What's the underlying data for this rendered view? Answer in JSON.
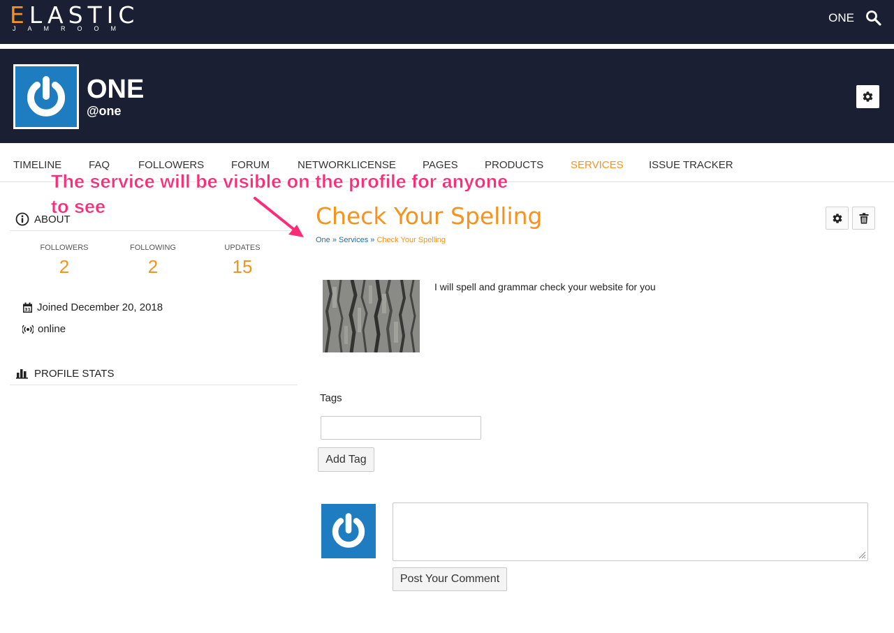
{
  "topbar": {
    "logo_first": "E",
    "logo_rest": "LASTIC",
    "logo_sub": "JAMROOM",
    "user_label": "ONE",
    "search_icon": "search-icon"
  },
  "profile": {
    "name": "ONE",
    "handle": "@one",
    "avatar_icon": "power-icon",
    "settings_icon": "gear-icon"
  },
  "nav": {
    "items": [
      {
        "label": "TIMELINE"
      },
      {
        "label": "FAQ"
      },
      {
        "label": "FOLLOWERS"
      },
      {
        "label": "FORUM"
      },
      {
        "label": "NETWORKLICENSE"
      },
      {
        "label": "PAGES"
      },
      {
        "label": "PRODUCTS"
      },
      {
        "label": "SERVICES",
        "active": true
      },
      {
        "label": "ISSUE TRACKER"
      }
    ]
  },
  "annotation": {
    "text": "The service will be visible on the profile for anyone to see",
    "color": "#ff2a78"
  },
  "sidebar": {
    "about_heading": "ABOUT",
    "stats": [
      {
        "label": "FOLLOWERS",
        "value": "2"
      },
      {
        "label": "FOLLOWING",
        "value": "2"
      },
      {
        "label": "UPDATES",
        "value": "15"
      }
    ],
    "joined": "Joined December 20, 2018",
    "status": "online",
    "profile_stats_heading": "PROFILE STATS"
  },
  "main": {
    "title": "Check Your Spelling",
    "breadcrumb": {
      "home": "One",
      "section": "Services",
      "current": "Check Your Spelling",
      "separator": "»"
    },
    "description": "I will spell and grammar check your website for you",
    "tags_label": "Tags",
    "tag_input_value": "",
    "add_tag_label": "Add Tag",
    "comment_value": "",
    "post_comment_label": "Post Your Comment"
  },
  "colors": {
    "header_bg": "#1a1f33",
    "accent": "#f7921e",
    "link": "#1e6fb3",
    "avatar_bg": "#1e7cc1"
  }
}
